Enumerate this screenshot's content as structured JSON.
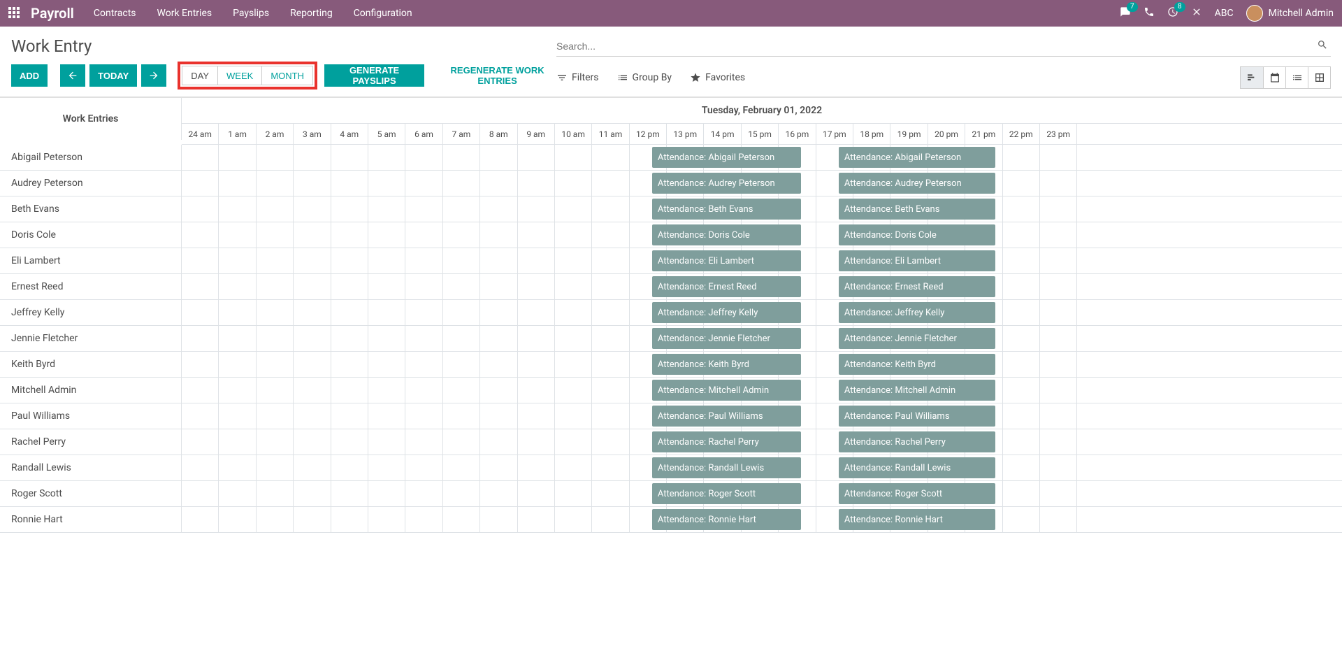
{
  "nav": {
    "brand": "Payroll",
    "menu": [
      "Contracts",
      "Work Entries",
      "Payslips",
      "Reporting",
      "Configuration"
    ],
    "msg_badge": "7",
    "activity_badge": "8",
    "company": "ABC",
    "user": "Mitchell Admin"
  },
  "page": {
    "title": "Work Entry",
    "add": "ADD",
    "today": "TODAY",
    "day": "DAY",
    "week": "WEEK",
    "month": "MONTH",
    "generate": "GENERATE PAYSLIPS",
    "regenerate": "REGENERATE WORK ENTRIES",
    "search_placeholder": "Search...",
    "filters": "Filters",
    "groupby": "Group By",
    "favorites": "Favorites"
  },
  "gantt": {
    "left_header": "Work Entries",
    "date": "Tuesday, February 01, 2022",
    "hours": [
      "24 am",
      "1 am",
      "2 am",
      "3 am",
      "4 am",
      "5 am",
      "6 am",
      "7 am",
      "8 am",
      "9 am",
      "10 am",
      "11 am",
      "12 pm",
      "13 pm",
      "14 pm",
      "15 pm",
      "16 pm",
      "17 pm",
      "18 pm",
      "19 pm",
      "20 pm",
      "21 pm",
      "22 pm",
      "23 pm"
    ],
    "rows": [
      {
        "name": "Abigail Peterson",
        "bar1": "Attendance: Abigail Peterson",
        "bar2": "Attendance: Abigail Peterson"
      },
      {
        "name": "Audrey Peterson",
        "bar1": "Attendance: Audrey Peterson",
        "bar2": "Attendance: Audrey Peterson"
      },
      {
        "name": "Beth Evans",
        "bar1": "Attendance: Beth Evans",
        "bar2": "Attendance: Beth Evans"
      },
      {
        "name": "Doris Cole",
        "bar1": "Attendance: Doris Cole",
        "bar2": "Attendance: Doris Cole"
      },
      {
        "name": "Eli Lambert",
        "bar1": "Attendance: Eli Lambert",
        "bar2": "Attendance: Eli Lambert"
      },
      {
        "name": "Ernest Reed",
        "bar1": "Attendance: Ernest Reed",
        "bar2": "Attendance: Ernest Reed"
      },
      {
        "name": "Jeffrey Kelly",
        "bar1": "Attendance: Jeffrey Kelly",
        "bar2": "Attendance: Jeffrey Kelly"
      },
      {
        "name": "Jennie Fletcher",
        "bar1": "Attendance: Jennie Fletcher",
        "bar2": "Attendance: Jennie Fletcher"
      },
      {
        "name": "Keith Byrd",
        "bar1": "Attendance: Keith Byrd",
        "bar2": "Attendance: Keith Byrd"
      },
      {
        "name": "Mitchell Admin",
        "bar1": "Attendance: Mitchell Admin",
        "bar2": "Attendance: Mitchell Admin"
      },
      {
        "name": "Paul Williams",
        "bar1": "Attendance: Paul Williams",
        "bar2": "Attendance: Paul Williams"
      },
      {
        "name": "Rachel Perry",
        "bar1": "Attendance: Rachel Perry",
        "bar2": "Attendance: Rachel Perry"
      },
      {
        "name": "Randall Lewis",
        "bar1": "Attendance: Randall Lewis",
        "bar2": "Attendance: Randall Lewis"
      },
      {
        "name": "Roger Scott",
        "bar1": "Attendance: Roger Scott",
        "bar2": "Attendance: Roger Scott"
      },
      {
        "name": "Ronnie Hart",
        "bar1": "Attendance: Ronnie Hart",
        "bar2": "Attendance: Ronnie Hart"
      }
    ]
  }
}
